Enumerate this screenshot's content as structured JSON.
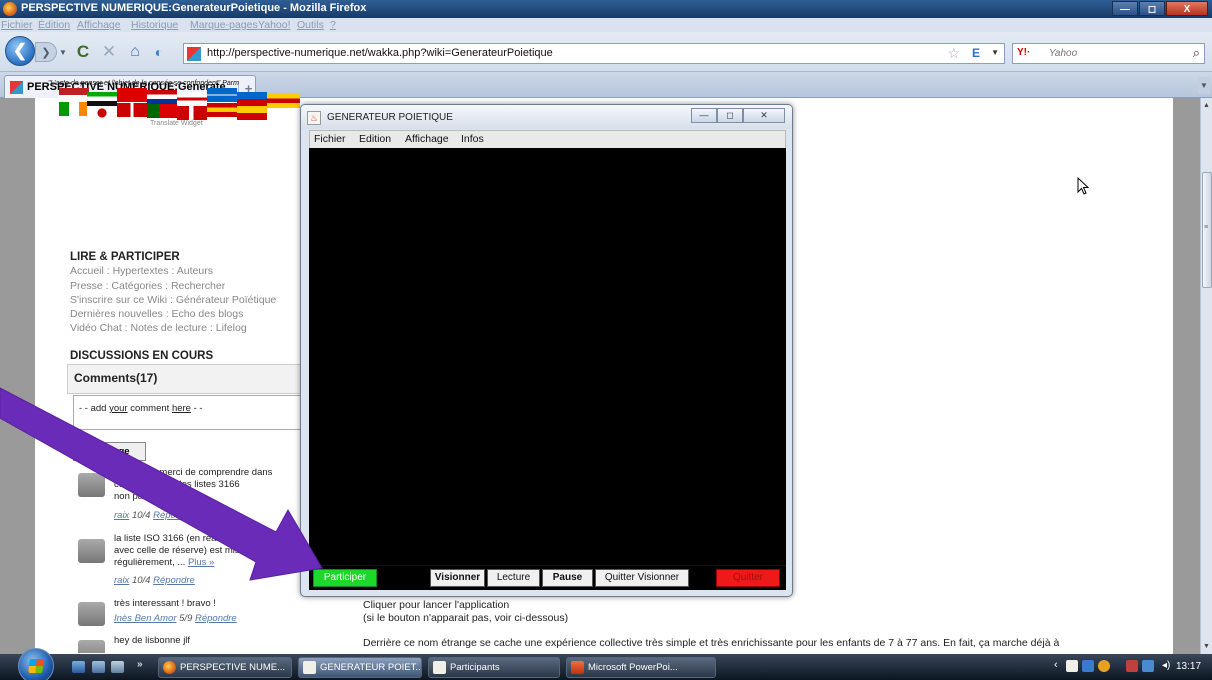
{
  "window": {
    "title": "PERSPECTIVE NUMERIQUE:GenerateurPoietique - Mozilla Firefox",
    "min": "—",
    "max": "◻",
    "close": "X"
  },
  "menubar": [
    "Fichier",
    "Édition",
    "Affichage",
    "Historique",
    "Marque-pages",
    "Yahoo!",
    "Outils",
    "?"
  ],
  "navbar": {
    "back": "❮",
    "forward": "❯",
    "url": "http://perspective-numerique.net/wakka.php?wiki=GenerateurPoietique",
    "search_placeholder": "Yahoo",
    "search_engine": "Y!·"
  },
  "tab": {
    "label": "PERSPECTIVE NUMERIQUE:Generate...",
    "new_tab": "+"
  },
  "page": {
    "quote": "\"L'acte de penser et l'objet de la pensée se confondent\" Parm",
    "translate_label": "Translate Widget",
    "lire_title": "LIRE & PARTICIPER",
    "nav_lines": [
      "Accueil : Hypertextes : Auteurs",
      "Presse : Catégories : Rechercher",
      "S'inscrire sur ce Wiki : Générateur Poïétique",
      "Dernières nouvelles : Echo des blogs",
      "Vidéo Chat : Notes de lecture : Lifelog"
    ],
    "discussions_title": "DISCUSSIONS EN COURS",
    "comments_header": "Comments(17)",
    "comment_prefix": "- - add ",
    "comment_link1": "your",
    "comment_mid": " comment ",
    "comment_link2": "here",
    "comment_suffix": " - -",
    "message_button": "Message",
    "comments": [
      {
        "lines": [
          "...ification, merci de comprendre dans",
          "co... précédent les listes 3166",
          "non pas ..."
        ],
        "more": "Plus »",
        "author": "raix",
        "date": " 10/4 ",
        "reply": "Répondre"
      },
      {
        "lines": [
          "la liste ISO 3166 (en réalité",
          "avec celle de réserve) est mise",
          "régulièrement, ..."
        ],
        "more": "Plus »",
        "author": "raix",
        "date": " 10/4 ",
        "reply": "Répondre"
      },
      {
        "lines": [
          "très interessant ! bravo !"
        ],
        "more": "",
        "author": "Inès Ben Amor",
        "date": " 5/9 ",
        "reply": "Répondre"
      },
      {
        "lines": [
          "hey de lisbonne jlf"
        ],
        "more": "",
        "author": "",
        "date": "",
        "reply": ""
      }
    ],
    "intro_1": "Cliquer pour lancer l'application",
    "intro_2": "(si le bouton n'apparait pas, voir ci-dessous)",
    "intro_3": "Derrière ce nom étrange se cache une expérience collective très simple et très enrichissante pour les enfants de 7 à 77 ans. En fait, ça marche déjà à"
  },
  "dialog": {
    "title": "GENERATEUR POIETIQUE",
    "menu": [
      "Fichier",
      "Edition",
      "Affichage",
      "Infos"
    ],
    "buttons": {
      "participer": "Participer",
      "visionner": "Visionner",
      "lecture": "Lecture",
      "pause": "Pause",
      "quitter_visionner": "Quitter Visionner",
      "quitter": "Quitter"
    },
    "colors": {
      "participer": "#1bd82a",
      "quitter": "#ee1a1a",
      "canvas": "#000000"
    }
  },
  "annotation": {
    "arrow_color": "#6a2bb8"
  },
  "taskbar": {
    "tasks": [
      "PERSPECTIVE NUME...",
      "GENERATEUR POIET...",
      "Participants",
      "Microsoft PowerPoi..."
    ],
    "more": "»",
    "clock": "13:17"
  }
}
